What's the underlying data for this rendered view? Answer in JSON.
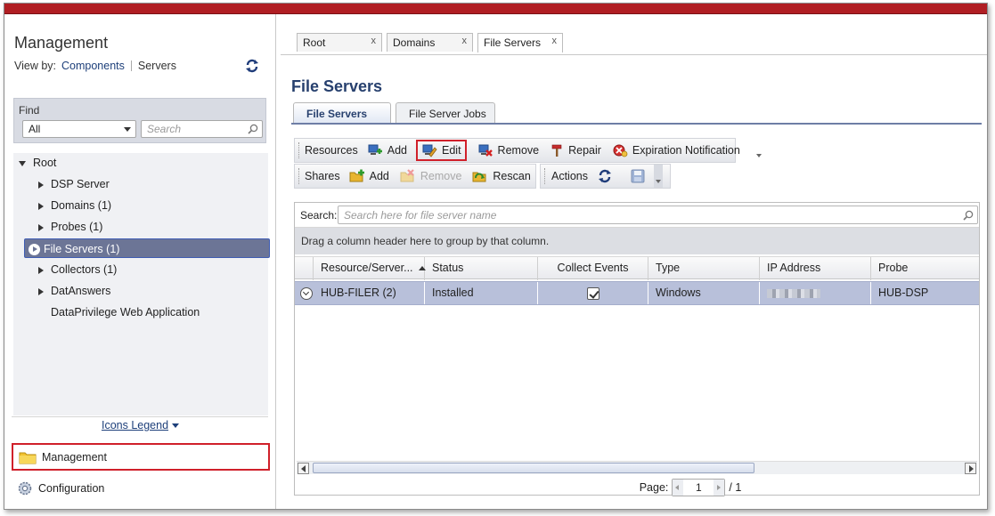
{
  "left_panel": {
    "title": "Management",
    "view_by_label": "View by:",
    "view_components": "Components",
    "view_servers": "Servers",
    "find_label": "Find",
    "find_select_value": "All",
    "find_search_placeholder": "Search",
    "tree": {
      "root": "Root",
      "items": [
        {
          "label": "DSP Server"
        },
        {
          "label": "Domains (1)"
        },
        {
          "label": "Probes (1)"
        },
        {
          "label": "File Servers (1)"
        },
        {
          "label": "Collectors (1)"
        },
        {
          "label": "DatAnswers"
        },
        {
          "label": "DataPrivilege Web Application"
        }
      ]
    },
    "icons_legend": "Icons Legend",
    "nav_management": "Management",
    "nav_configuration": "Configuration"
  },
  "doc_tabs": [
    {
      "label": "Root",
      "close": "x"
    },
    {
      "label": "Domains",
      "close": "x"
    },
    {
      "label": "File Servers",
      "close": "x"
    }
  ],
  "page_title": "File Servers",
  "sub_tabs": [
    "File Servers",
    "File Server Jobs"
  ],
  "toolbar": {
    "resources_label": "Resources",
    "add": "Add",
    "edit": "Edit",
    "remove": "Remove",
    "repair": "Repair",
    "expiration": "Expiration Notification",
    "shares_label": "Shares",
    "share_add": "Add",
    "share_remove": "Remove",
    "rescan": "Rescan",
    "actions_label": "Actions"
  },
  "grid": {
    "search_label": "Search:",
    "search_placeholder": "Search here for file server name",
    "group_hint": "Drag a column header here to group by that column.",
    "columns": [
      "Resource/Server...",
      "Status",
      "Collect Events",
      "Type",
      "IP Address",
      "Probe"
    ],
    "rows": [
      {
        "resource": "HUB-FILER (2)",
        "status": "Installed",
        "collect_events": true,
        "type": "Windows",
        "ip": "",
        "probe": "HUB-DSP"
      }
    ]
  },
  "pager": {
    "label": "Page:",
    "current": "1",
    "total": "/ 1"
  },
  "colors": {
    "top_bar": "#b01e23",
    "selection": "#6c7596",
    "highlight_border": "#d0202a",
    "title_blue": "#27406e",
    "row_selected": "#b8c0da"
  }
}
